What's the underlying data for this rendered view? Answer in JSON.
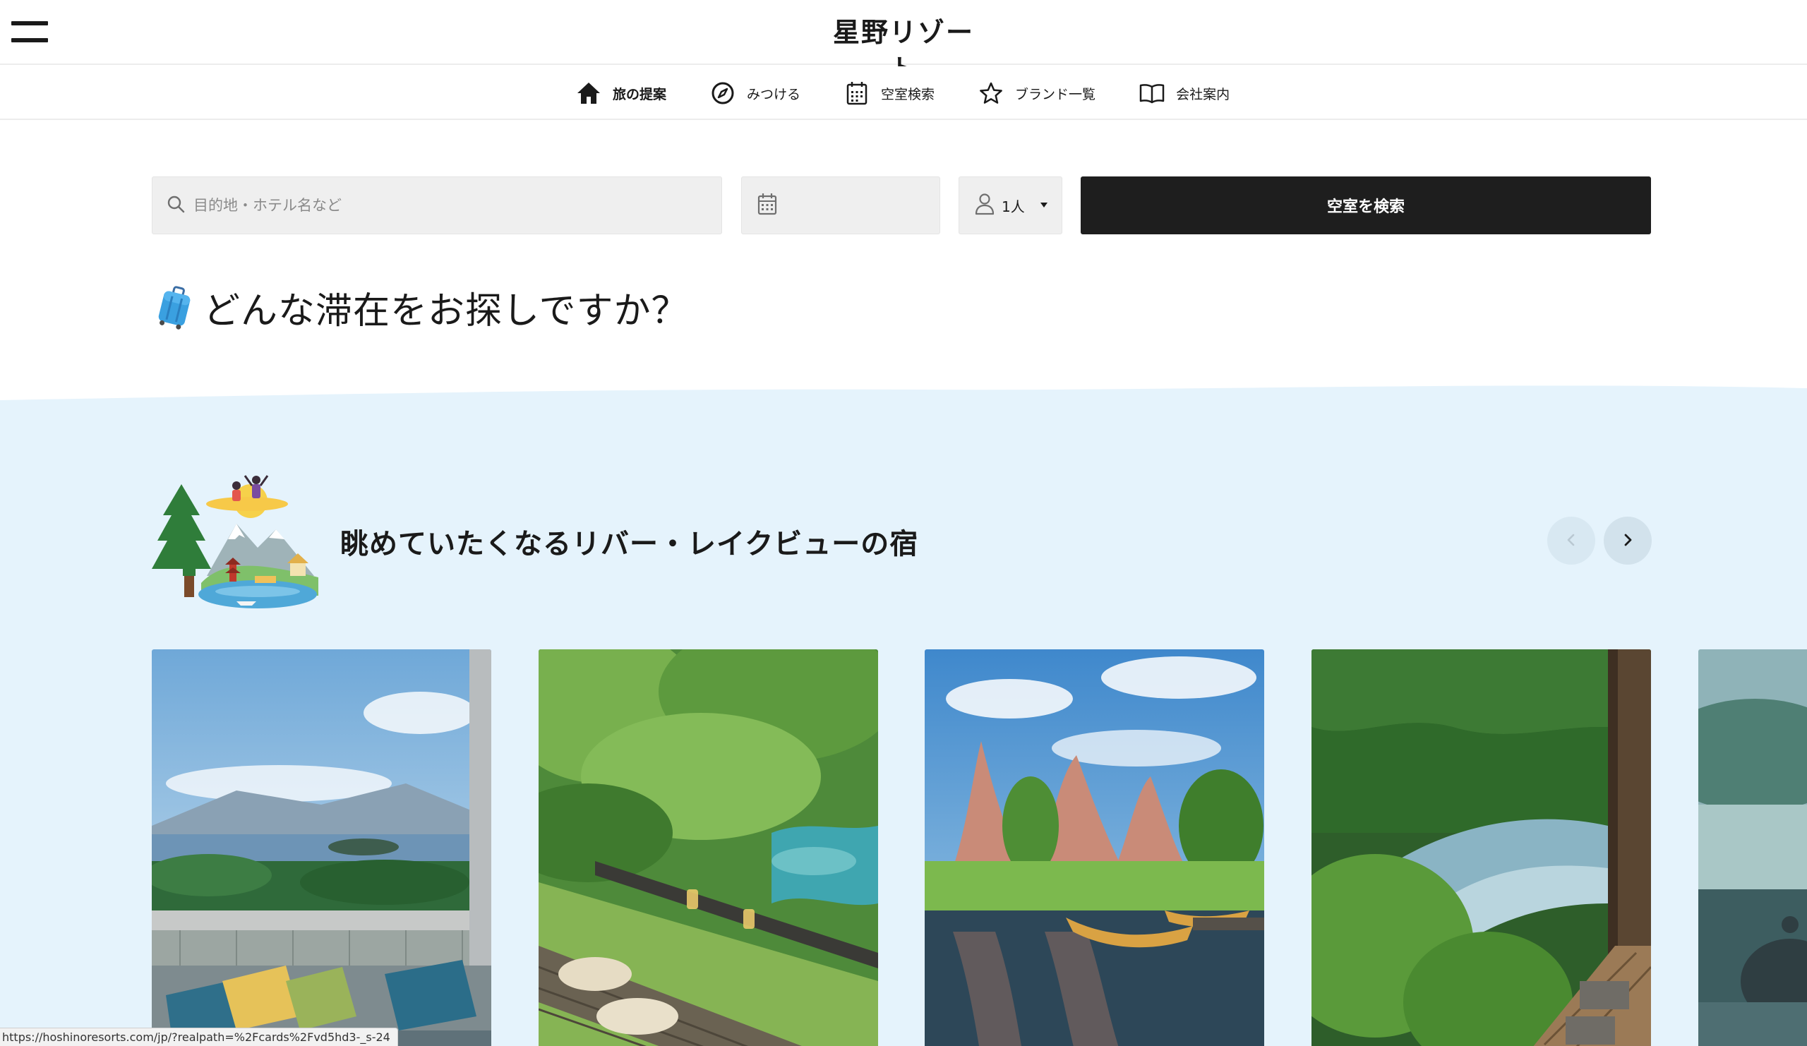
{
  "header": {
    "logo_text": "星野リゾート"
  },
  "nav": {
    "items": [
      {
        "label": "旅の提案",
        "icon": "home-icon",
        "active": true
      },
      {
        "label": "みつける",
        "icon": "compass-icon",
        "active": false
      },
      {
        "label": "空室検索",
        "icon": "calendar-icon",
        "active": false
      },
      {
        "label": "ブランド一覧",
        "icon": "star-icon",
        "active": false
      },
      {
        "label": "会社案内",
        "icon": "book-icon",
        "active": false
      }
    ]
  },
  "search": {
    "destination_placeholder": "目的地・ホテル名など",
    "date_value": "",
    "guests_label": "1人",
    "submit_label": "空室を検索"
  },
  "main": {
    "title": "どんな滞在をお探しですか？",
    "section_title": "眺めていたくなるリバー・レイクビューの宿"
  },
  "colors": {
    "section_background": "#e5f3fc",
    "search_button": "#1e1e1e",
    "field_background": "#efefef"
  },
  "status_bar": {
    "url": "https://hoshinoresorts.com/jp/?realpath=%2Fcards%2Fvd5hd3-_s-24"
  }
}
